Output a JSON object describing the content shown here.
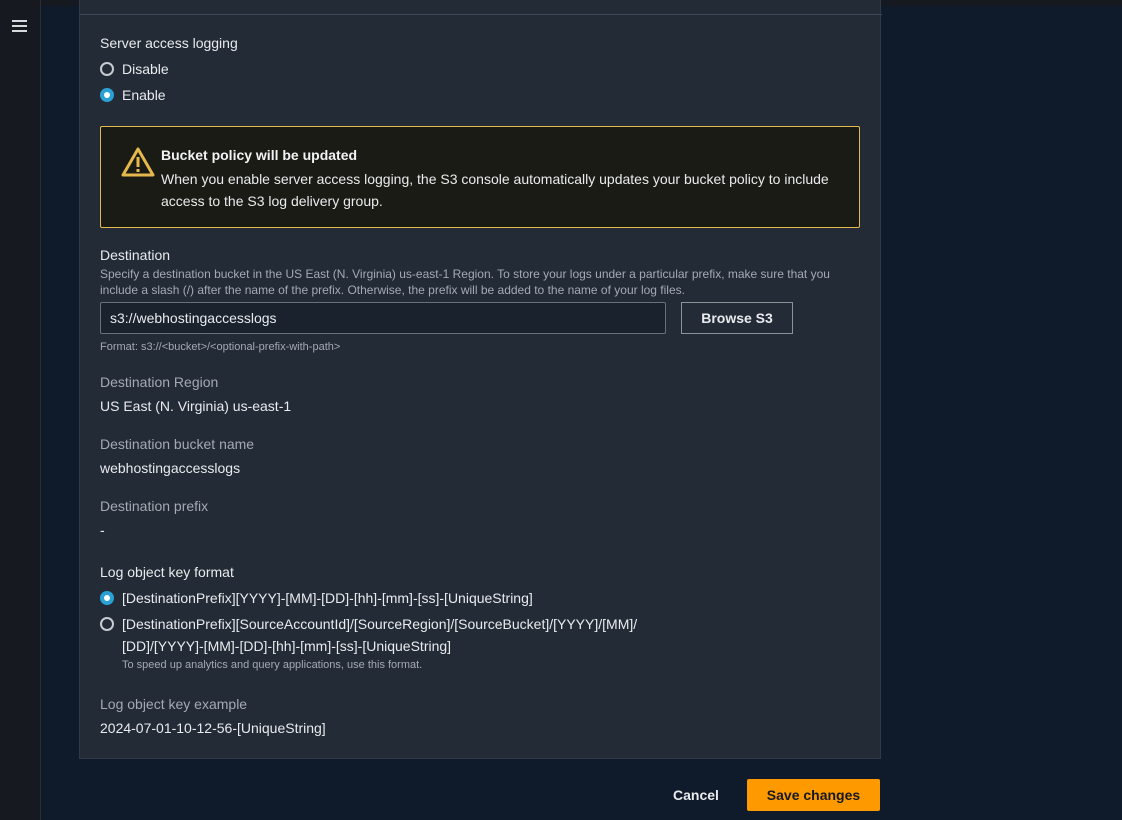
{
  "server_access_logging": {
    "label": "Server access logging",
    "options": [
      {
        "label": "Disable",
        "checked": false
      },
      {
        "label": "Enable",
        "checked": true
      }
    ]
  },
  "warning": {
    "icon": "warning-icon",
    "title": "Bucket policy will be updated",
    "body": "When you enable server access logging, the S3 console automatically updates your bucket policy to include access to the S3 log delivery group."
  },
  "destination": {
    "label": "Destination",
    "description": "Specify a destination bucket in the US East (N. Virginia) us-east-1 Region. To store your logs under a particular prefix, make sure that you include a slash (/) after the name of the prefix. Otherwise, the prefix will be added to the name of your log files.",
    "value": "s3://webhostingaccesslogs",
    "browse_label": "Browse S3",
    "format_hint": "Format: s3://<bucket>/<optional-prefix-with-path>"
  },
  "destination_region": {
    "label": "Destination Region",
    "value": "US East (N. Virginia) us-east-1"
  },
  "destination_bucket": {
    "label": "Destination bucket name",
    "value": "webhostingaccesslogs"
  },
  "destination_prefix": {
    "label": "Destination prefix",
    "value": "-"
  },
  "log_key_format": {
    "label": "Log object key format",
    "options": [
      {
        "label": "[DestinationPrefix][YYYY]-[MM]-[DD]-[hh]-[mm]-[ss]-[UniqueString]",
        "checked": true
      },
      {
        "label_line1": "[DestinationPrefix][SourceAccountId]/[SourceRegion]/[SourceBucket]/[YYYY]/[MM]/",
        "label_line2": "[DD]/[YYYY]-[MM]-[DD]-[hh]-[mm]-[ss]-[UniqueString]",
        "hint": "To speed up analytics and query applications, use this format.",
        "checked": false
      }
    ]
  },
  "log_key_example": {
    "label": "Log object key example",
    "value": "2024-07-01-10-12-56-[UniqueString]"
  },
  "footer": {
    "cancel_label": "Cancel",
    "save_label": "Save changes"
  },
  "colors": {
    "accent": "#ff9900",
    "radio_selected": "#29a1d4",
    "warning_border": "#e4b84d"
  }
}
